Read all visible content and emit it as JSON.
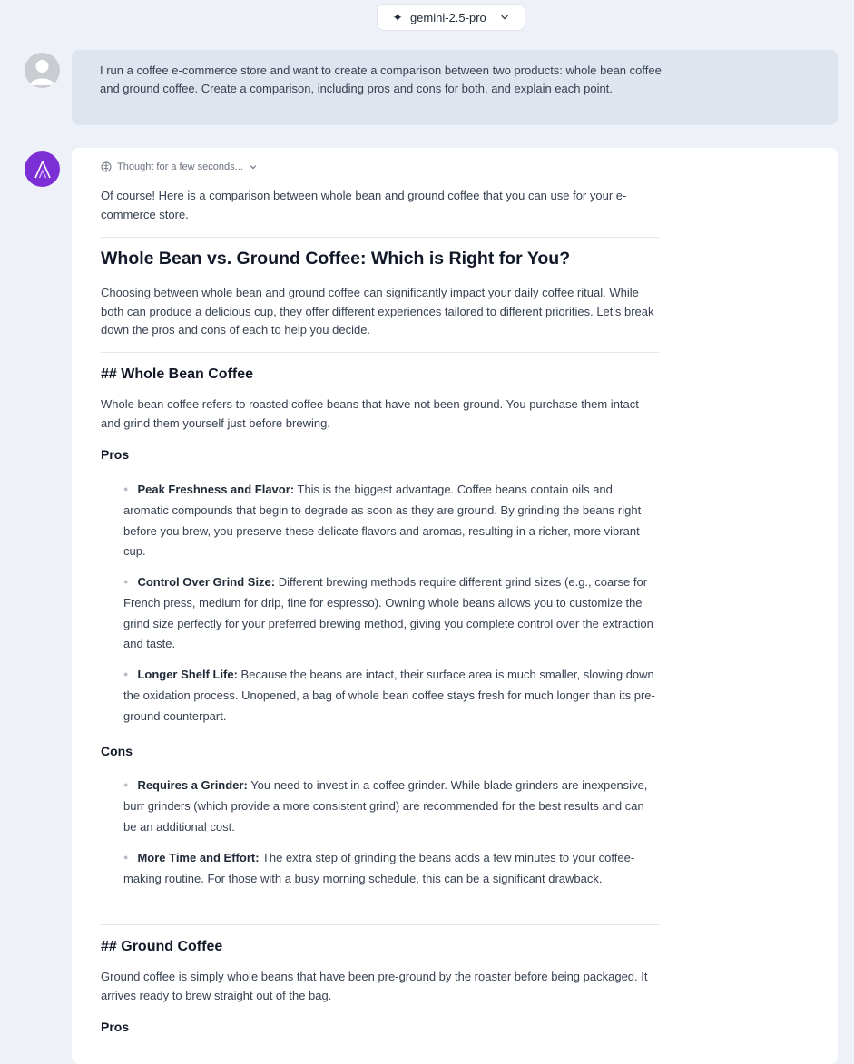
{
  "header": {
    "model_name": "gemini-2.5-pro"
  },
  "user_message": {
    "text": "I run a coffee e-commerce store and want to create a comparison between two products: whole bean coffee and ground coffee. Create a comparison, including pros and cons for both, and explain each point."
  },
  "assistant": {
    "thought_label": "Thought for a few seconds...",
    "intro": "Of course! Here is a comparison between whole bean and ground coffee that you can use for your e-commerce store.",
    "title": "Whole Bean vs. Ground Coffee: Which is Right for You?",
    "title_paragraph": "Choosing between whole bean and ground coffee can significantly impact your daily coffee ritual. While both can produce a delicious cup, they offer different experiences tailored to different priorities. Let's break down the pros and cons of each to help you decide.",
    "whole_bean": {
      "heading": "## Whole Bean Coffee",
      "description": "Whole bean coffee refers to roasted coffee beans that have not been ground. You purchase them intact and grind them yourself just before brewing.",
      "pros_label": "Pros",
      "pros": [
        {
          "title": "Peak Freshness and Flavor:",
          "text": " This is the biggest advantage. Coffee beans contain oils and aromatic compounds that begin to degrade as soon as they are ground. By grinding the beans right before you brew, you preserve these delicate flavors and aromas, resulting in a richer, more vibrant cup."
        },
        {
          "title": "Control Over Grind Size:",
          "text": " Different brewing methods require different grind sizes (e.g., coarse for French press, medium for drip, fine for espresso). Owning whole beans allows you to customize the grind size perfectly for your preferred brewing method, giving you complete control over the extraction and taste."
        },
        {
          "title": "Longer Shelf Life:",
          "text": " Because the beans are intact, their surface area is much smaller, slowing down the oxidation process. Unopened, a bag of whole bean coffee stays fresh for much longer than its pre-ground counterpart."
        }
      ],
      "cons_label": "Cons",
      "cons": [
        {
          "title": "Requires a Grinder:",
          "text": " You need to invest in a coffee grinder. While blade grinders are inexpensive, burr grinders (which provide a more consistent grind) are recommended for the best results and can be an additional cost."
        },
        {
          "title": "More Time and Effort:",
          "text": " The extra step of grinding the beans adds a few minutes to your coffee-making routine. For those with a busy morning schedule, this can be a significant drawback."
        }
      ]
    },
    "ground": {
      "heading": "## Ground Coffee",
      "description": "Ground coffee is simply whole beans that have been pre-ground by the roaster before being packaged. It arrives ready to brew straight out of the bag.",
      "pros_label": "Pros"
    }
  },
  "colors": {
    "ai_avatar": "#7d2fd6",
    "background": "#eef2f8",
    "user_bubble": "#dfe5ee"
  }
}
